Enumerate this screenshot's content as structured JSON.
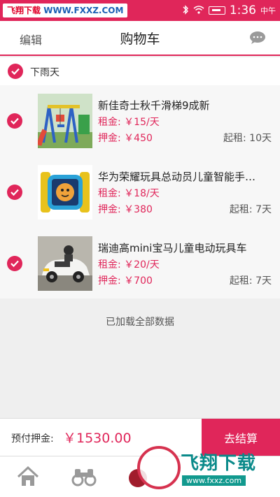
{
  "status_bar": {
    "watermark_red": "飞翔下载",
    "watermark_blue": "WWW.FXXZ.COM",
    "time": "1:36",
    "ampm": "中午"
  },
  "header": {
    "edit_label": "编辑",
    "title": "购物车",
    "message_icon": "chat-bubble-icon"
  },
  "store": {
    "name": "下雨天",
    "checked": true
  },
  "items": [
    {
      "title": "新佳奇士秋千滑梯9成新",
      "rent": "租金: ￥15/天",
      "deposit": "押金: ￥450",
      "min_rent": "起租: 10天",
      "checked": true
    },
    {
      "title": "华为荣耀玩具总动员儿童智能手…",
      "rent": "租金: ￥18/天",
      "deposit": "押金: ￥380",
      "min_rent": "起租: 7天",
      "checked": true
    },
    {
      "title": "瑞迪高mini宝马儿童电动玩具车",
      "rent": "租金: ￥20/天",
      "deposit": "押金: ￥700",
      "min_rent": "起租: 7天",
      "checked": true
    }
  ],
  "loaded_note": "已加载全部数据",
  "footer": {
    "deposit_label": "预付押金:",
    "deposit_value": "￥1530.00",
    "checkout_label": "去结算"
  },
  "watermark_bottom": {
    "title": "飞翔下载",
    "url": "www.fxxz.com"
  },
  "colors": {
    "accent": "#e0265a",
    "watermark_teal": "#11998e"
  }
}
